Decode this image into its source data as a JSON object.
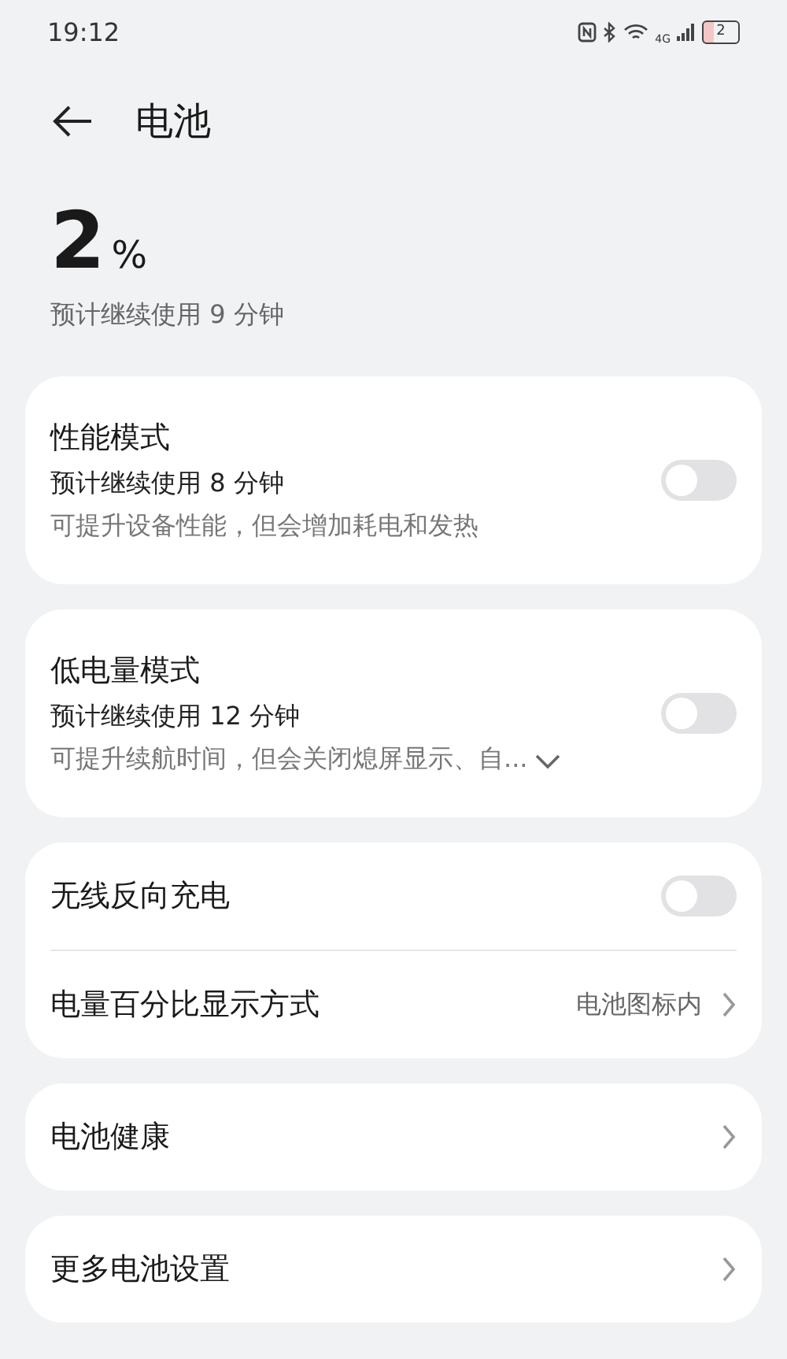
{
  "status_bar": {
    "time": "19:12",
    "network": "4G",
    "battery": "2"
  },
  "header": {
    "title": "电池"
  },
  "summary": {
    "percent": "2",
    "unit": "%",
    "estimate": "预计继续使用 9 分钟"
  },
  "cards": [
    {
      "rows": [
        {
          "kind": "toggle",
          "title": "性能模式",
          "subtitle": "预计继续使用 8 分钟",
          "description": "可提升设备性能，但会增加耗电和发热",
          "on": false
        }
      ]
    },
    {
      "rows": [
        {
          "kind": "toggle",
          "title": "低电量模式",
          "subtitle": "预计继续使用 12 分钟",
          "description": "可提升续航时间，但会关闭熄屏显示、自...",
          "expandable": true,
          "on": false
        }
      ]
    },
    {
      "rows": [
        {
          "kind": "toggle",
          "title": "无线反向充电",
          "on": false
        },
        {
          "kind": "link",
          "title": "电量百分比显示方式",
          "value": "电池图标内"
        }
      ]
    },
    {
      "rows": [
        {
          "kind": "link",
          "title": "电池健康"
        }
      ]
    },
    {
      "rows": [
        {
          "kind": "link",
          "title": "更多电池设置"
        }
      ]
    }
  ]
}
